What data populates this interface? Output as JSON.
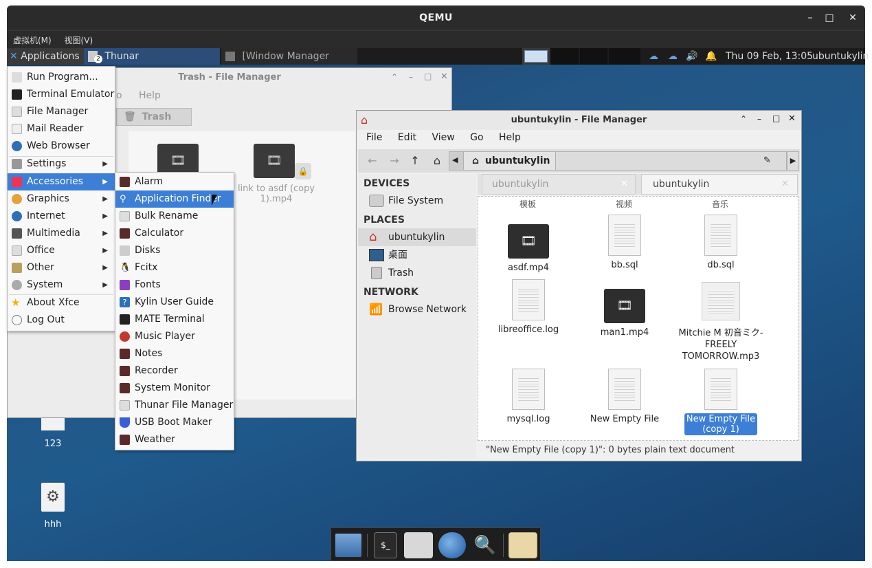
{
  "qemu": {
    "title": "QEMU",
    "menu": [
      "虚拟机(M)",
      "视图(V)"
    ],
    "controls": {
      "minimize": "–",
      "maximize": "□",
      "close": "✕"
    }
  },
  "panel": {
    "applications_label": "Applications",
    "task_thunar": "Thunar",
    "task_thunar_badge": "2",
    "task_wm": "[Window Manager Twea...",
    "clock": "Thu 09 Feb, 13:05",
    "user": "ubuntukylin"
  },
  "trash_window": {
    "title": "Trash - File Manager",
    "menu_partial": [
      "o",
      "Help"
    ],
    "location": "Trash",
    "file_label": "link to asdf (copy 1).mp4"
  },
  "main_window": {
    "title": "ubuntukylin - File Manager",
    "menu": [
      "File",
      "Edit",
      "View",
      "Go",
      "Help"
    ],
    "location": "ubuntukylin",
    "sidebar": {
      "devices_header": "DEVICES",
      "file_system": "File System",
      "places_header": "PLACES",
      "home": "ubuntukylin",
      "desktop": "桌面",
      "trash": "Trash",
      "network_header": "NETWORK",
      "browse_network": "Browse Network"
    },
    "tabs": [
      "ubuntukylin",
      "ubuntukylin"
    ],
    "columns": [
      "模板",
      "视频",
      "音乐"
    ],
    "files": [
      {
        "name": "asdf.mp4",
        "kind": "video"
      },
      {
        "name": "bb.sql",
        "kind": "doc"
      },
      {
        "name": "db.sql",
        "kind": "doc"
      },
      {
        "name": "libreoffice.log",
        "kind": "doc"
      },
      {
        "name": "man1.mp4",
        "kind": "video"
      },
      {
        "name": "Mitchie M 初音ミク-FREELY TOMORROW.mp3",
        "kind": "audio"
      },
      {
        "name": "mysql.log",
        "kind": "doc"
      },
      {
        "name": "New Empty File",
        "kind": "doc"
      },
      {
        "name": "New Empty File (copy 1)",
        "kind": "doc",
        "selected": true
      }
    ],
    "status": "\"New Empty File (copy 1)\": 0 bytes plain text document"
  },
  "apps_menu": {
    "items": [
      {
        "label": "Run Program...",
        "icon": "run-icon"
      },
      {
        "label": "Terminal Emulator",
        "icon": "terminal-icon"
      },
      {
        "label": "File Manager",
        "icon": "folder-icon"
      },
      {
        "label": "Mail Reader",
        "icon": "mail-icon"
      },
      {
        "label": "Web Browser",
        "icon": "globe-icon"
      },
      {
        "label": "Settings",
        "icon": "settings-icon",
        "submenu": true
      },
      {
        "label": "Accessories",
        "icon": "accessories-icon",
        "submenu": true,
        "selected": true
      },
      {
        "label": "Graphics",
        "icon": "graphics-icon",
        "submenu": true
      },
      {
        "label": "Internet",
        "icon": "internet-icon",
        "submenu": true
      },
      {
        "label": "Multimedia",
        "icon": "multimedia-icon",
        "submenu": true
      },
      {
        "label": "Office",
        "icon": "office-icon",
        "submenu": true
      },
      {
        "label": "Other",
        "icon": "other-icon",
        "submenu": true
      },
      {
        "label": "System",
        "icon": "system-icon",
        "submenu": true
      },
      {
        "label": "About Xfce",
        "icon": "star-icon"
      },
      {
        "label": "Log Out",
        "icon": "logout-icon"
      }
    ]
  },
  "accessories_menu": {
    "items": [
      {
        "label": "Alarm",
        "icon": "alarm-icon"
      },
      {
        "label": "Application Finder",
        "icon": "magnifier-icon",
        "selected": true
      },
      {
        "label": "Bulk Rename",
        "icon": "rename-icon"
      },
      {
        "label": "Calculator",
        "icon": "calculator-icon"
      },
      {
        "label": "Disks",
        "icon": "disks-icon"
      },
      {
        "label": "Fcitx",
        "icon": "penguin-icon"
      },
      {
        "label": "Fonts",
        "icon": "fonts-icon"
      },
      {
        "label": "Kylin User Guide",
        "icon": "help-icon"
      },
      {
        "label": "MATE Terminal",
        "icon": "terminal-icon"
      },
      {
        "label": "Music Player",
        "icon": "music-icon"
      },
      {
        "label": "Notes",
        "icon": "notes-icon"
      },
      {
        "label": "Recorder",
        "icon": "recorder-icon"
      },
      {
        "label": "System Monitor",
        "icon": "monitor-icon"
      },
      {
        "label": "Thunar File Manager",
        "icon": "folder-icon"
      },
      {
        "label": "USB Boot Maker",
        "icon": "usb-icon"
      },
      {
        "label": "Weather",
        "icon": "weather-icon"
      }
    ]
  },
  "desktop_icons": [
    {
      "label": "123"
    },
    {
      "label": "hhh"
    }
  ],
  "colors": {
    "selection": "#3d7fd6",
    "panel": "#1c1c1c",
    "desktop": "#235685"
  }
}
